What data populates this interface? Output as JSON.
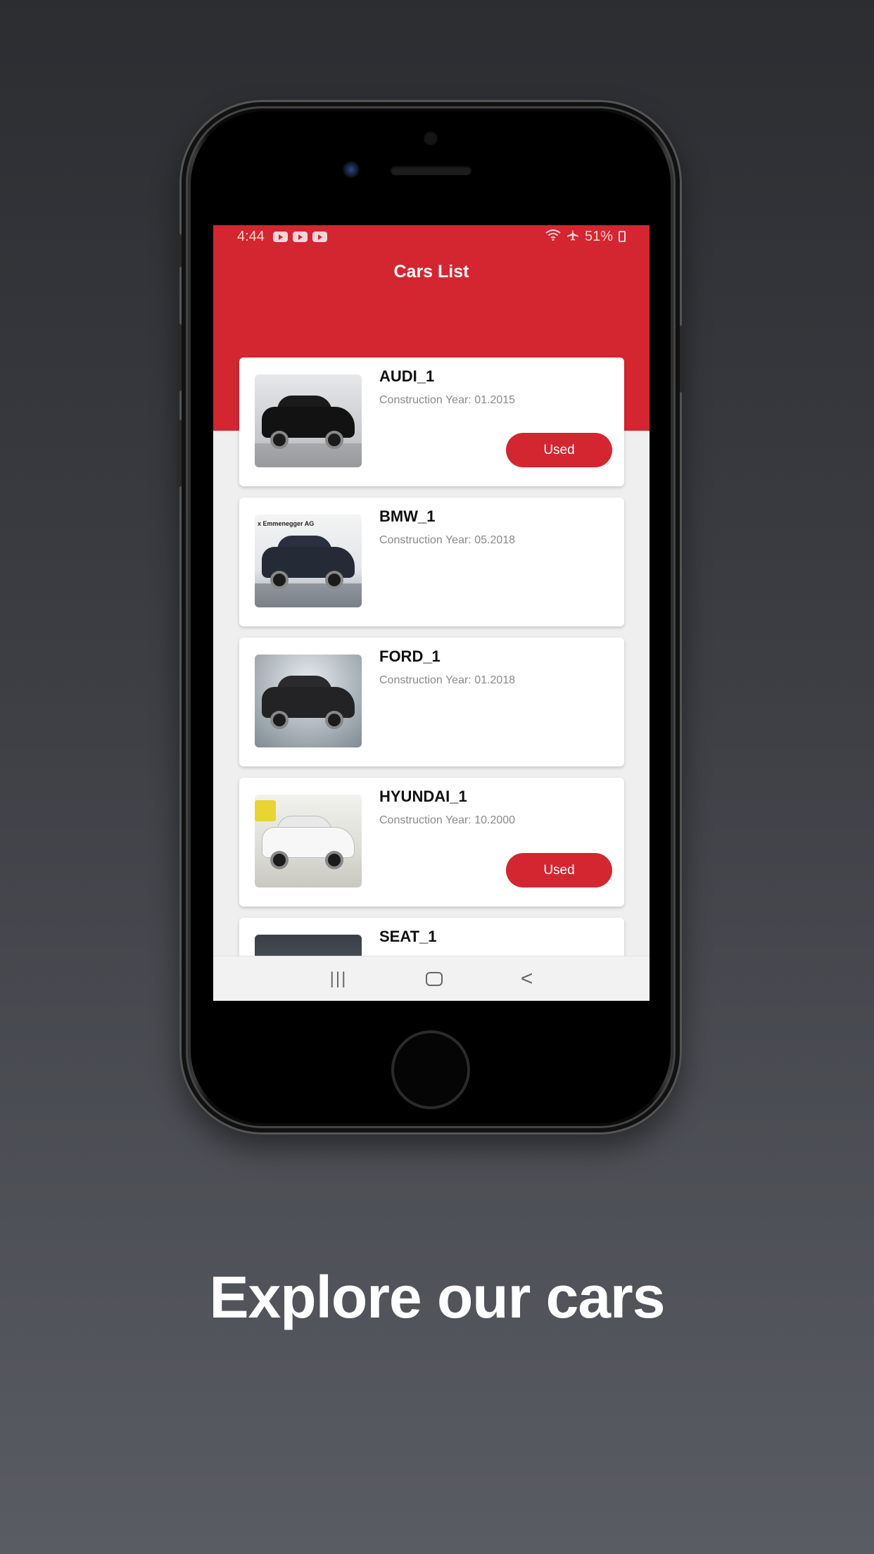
{
  "status_bar": {
    "time": "4:44",
    "battery": "51%",
    "notification_icons": [
      "youtube-icon",
      "youtube-icon",
      "youtube-icon"
    ],
    "right_icons": [
      "wifi-icon",
      "airplane-icon",
      "battery-icon"
    ]
  },
  "app": {
    "title": "Cars List",
    "accent_color": "#d32630"
  },
  "cars": [
    {
      "name": "AUDI_1",
      "year": "Construction Year: 01.2015",
      "badge": "Used"
    },
    {
      "name": "BMW_1",
      "year": "Construction Year: 05.2018",
      "thumb_text": "x Emmenegger AG"
    },
    {
      "name": "FORD_1",
      "year": "Construction Year: 01.2018"
    },
    {
      "name": "HYUNDAI_1",
      "year": "Construction Year: 10.2000",
      "badge": "Used"
    },
    {
      "name": "SEAT_1"
    }
  ],
  "nav": {
    "recents": "|||",
    "back": "<"
  },
  "tagline": "Explore our cars"
}
